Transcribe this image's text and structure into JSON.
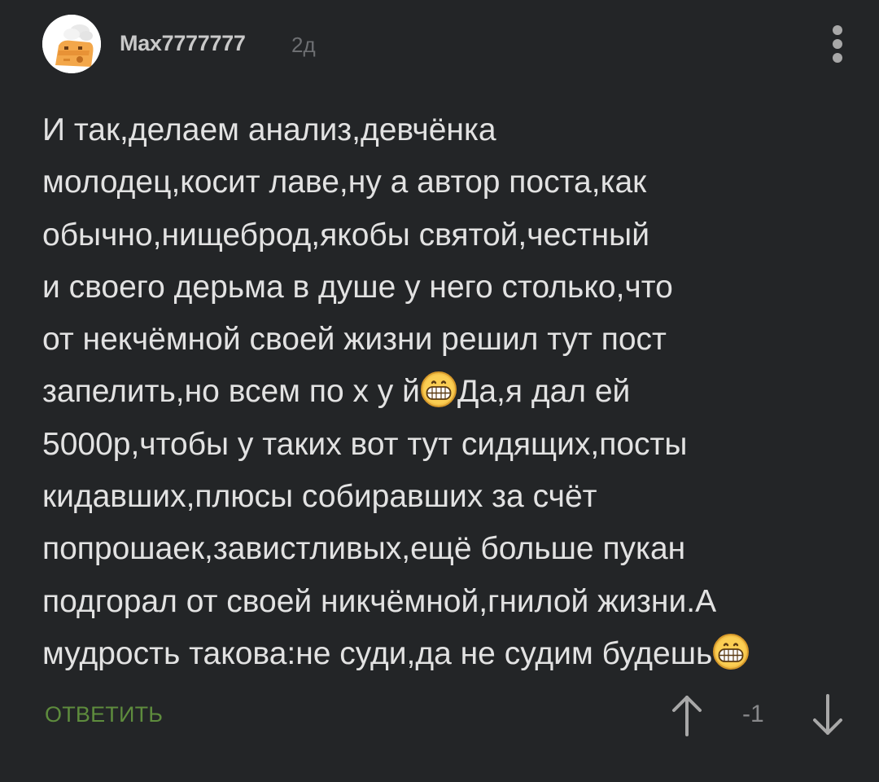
{
  "comment": {
    "author": "Max7777777",
    "time": "2д",
    "lines": {
      "l1": "И так,делаем анализ,девчёнка",
      "l2": "молодец,косит лаве,ну а автор поста,как",
      "l3": "обычно,нищеброд,якобы святой,честный",
      "l4": "и своего дерьма в душе у него столько,что",
      "l5": "от некчёмной своей жизни решил тут пост",
      "l6a": "запелить,но всем по х у й",
      "l6b": "Да,я дал ей",
      "l7": "5000р,чтобы у таких вот тут сидящих,посты",
      "l8": "кидавших,плюсы собиравших за счёт",
      "l9": "попрошаек,завистливых,ещё больше пукан",
      "l10": "подгорал от своей никчёмной,гнилой жизни.А",
      "l11": "мудрость такова:не суди,да не судим будешь"
    },
    "emoji": "grinning-face-emoji",
    "reply_label": "ОТВЕТИТЬ",
    "rating": "-1"
  },
  "colors": {
    "background": "#232527",
    "text": "#e2e2e2",
    "author": "#c9c9c9",
    "muted": "#6d6f72",
    "reply": "#5e8c3d",
    "icon": "#a8a8a8"
  },
  "icons": {
    "more": "vertical-ellipsis-icon",
    "upvote": "arrow-up-icon",
    "downvote": "arrow-down-icon"
  }
}
